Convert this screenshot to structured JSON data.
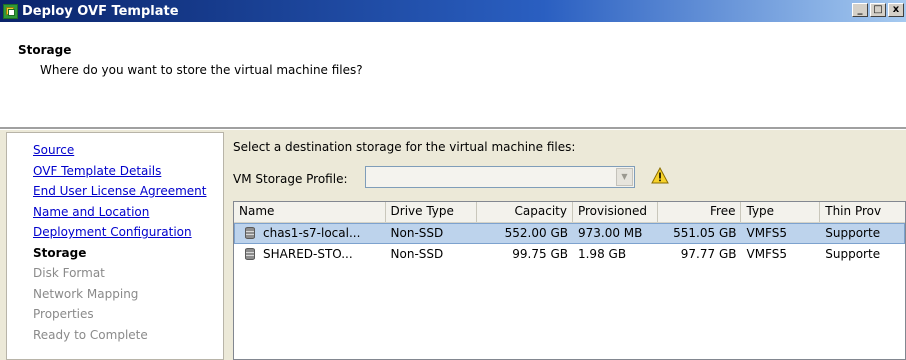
{
  "window": {
    "title": "Deploy OVF Template",
    "buttons": {
      "minimize": "_",
      "maximize": "□",
      "close": "x"
    }
  },
  "header": {
    "title": "Storage",
    "subtitle": "Where do you want to store the virtual machine files?"
  },
  "sidebar": {
    "items": [
      {
        "label": "Source",
        "state": "done"
      },
      {
        "label": "OVF Template Details",
        "state": "done"
      },
      {
        "label": "End User License Agreement",
        "state": "done"
      },
      {
        "label": "Name and Location",
        "state": "done"
      },
      {
        "label": "Deployment Configuration",
        "state": "done"
      },
      {
        "label": "Storage",
        "state": "current"
      },
      {
        "label": "Disk Format",
        "state": "future"
      },
      {
        "label": "Network Mapping",
        "state": "future"
      },
      {
        "label": "Properties",
        "state": "future"
      },
      {
        "label": "Ready to Complete",
        "state": "future"
      }
    ]
  },
  "content": {
    "prompt": "Select a destination storage for the virtual machine files:",
    "profile_label": "VM Storage Profile:",
    "profile_value": "",
    "profile_arrow": "▼",
    "warning_icon": "warning-icon"
  },
  "table": {
    "columns": [
      "Name",
      "Drive Type",
      "Capacity",
      "Provisioned",
      "Free",
      "Type",
      "Thin Prov"
    ],
    "rows": [
      {
        "name": "chas1-s7-local...",
        "drive_type": "Non-SSD",
        "capacity": "552.00 GB",
        "provisioned": "973.00 MB",
        "free": "551.05 GB",
        "type": "VMFS5",
        "thin": "Supporte",
        "selected": true
      },
      {
        "name": "SHARED-STO...",
        "drive_type": "Non-SSD",
        "capacity": "99.75 GB",
        "provisioned": "1.98 GB",
        "free": "97.77 GB",
        "type": "VMFS5",
        "thin": "Supporte",
        "selected": false
      }
    ]
  },
  "colors": {
    "titlebar": "#0a246a",
    "link": "#0000cc",
    "selected_row": "#bdd3ec",
    "panel_bg": "#ece9d8"
  }
}
